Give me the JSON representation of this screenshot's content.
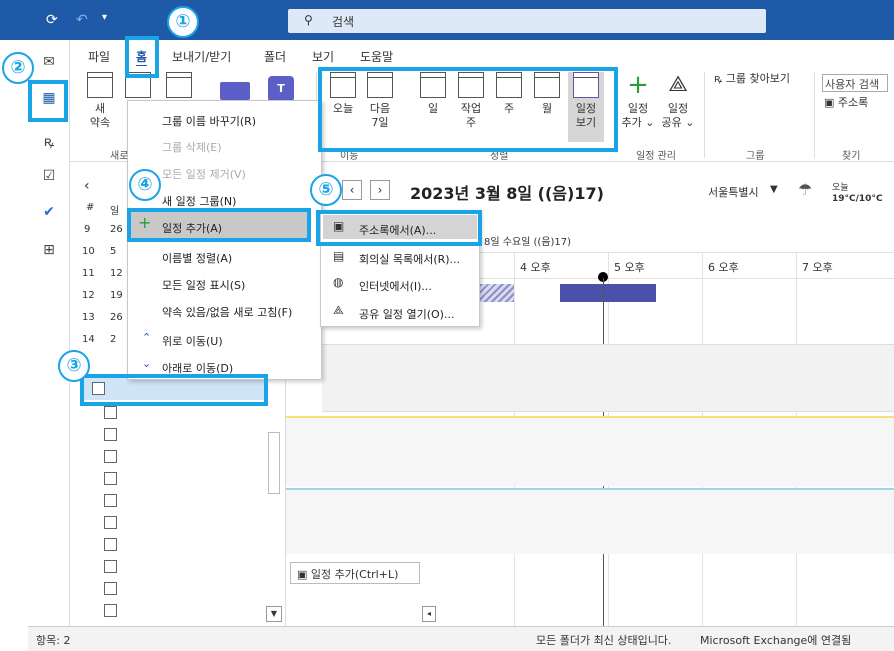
{
  "search": {
    "label": "검색"
  },
  "menu": {
    "tabs": [
      "파일",
      "홈",
      "보내기/받기",
      "폴더",
      "보기",
      "도움말"
    ]
  },
  "ribbon": {
    "new_appt": "새\n약속",
    "new_short": "새",
    "today": "오늘",
    "next7": "다음\n7일",
    "day": "일",
    "workweek": "작업\n주",
    "week": "주",
    "month": "월",
    "schedule": "일정\n보기",
    "add_cal": "일정\n추가 ⌄",
    "share_cal": "일정\n공유 ⌄",
    "find_group": "그룹 찾아보기",
    "search_people": "사용자 검색",
    "address_book": "주소록",
    "groups": {
      "new": "새로",
      "goto": "이동",
      "arrange": "정렬",
      "manage": "일정 관리",
      "group": "그룹",
      "find": "찾기"
    }
  },
  "ctx": {
    "items": [
      "그룹 이름 바꾸기(R)",
      "그룹 삭제(E)",
      "모든 일정 제거(V)",
      "새 일정 그룹(N)",
      "일정 추가(A)",
      "이름별 정렬(A)",
      "모든 일정 표시(S)",
      "약속 있음/없음 새로 고침(F)",
      "위로 이동(U)",
      "아래로 이동(D)"
    ]
  },
  "sub": {
    "items": [
      "주소록에서(A)...",
      "회의실 목록에서(R)...",
      "인터넷에서(I)...",
      "공유 일정 열기(O)..."
    ]
  },
  "calendar": {
    "date_title": "2023년 3월 8일  ((음)17)",
    "location": "서울특별시",
    "weather_label": "오늘",
    "weather_temp": "19°C/10°C",
    "day_header": "8일 수요일 ((음)17)",
    "hours": [
      "4 오후",
      "5 오후",
      "6 오후",
      "7 오후"
    ],
    "add_event": "일정 추가(Ctrl+L)"
  },
  "minical": {
    "header": [
      "#",
      "일"
    ],
    "weeks": [
      "9",
      "10",
      "11",
      "12",
      "13",
      "14"
    ],
    "days": [
      "26",
      "5",
      "12",
      "19",
      "26",
      "2"
    ]
  },
  "status": {
    "items": "항목: 2",
    "sync": "모든 폴더가 최신 상태입니다.",
    "conn": "Microsoft Exchange에 연결됨"
  },
  "badges": [
    "①",
    "②",
    "③",
    "④",
    "⑤"
  ],
  "colors": {
    "accent": "#1aa3e6",
    "titlebar": "#1e5aa8",
    "event": "#4b50a8"
  }
}
